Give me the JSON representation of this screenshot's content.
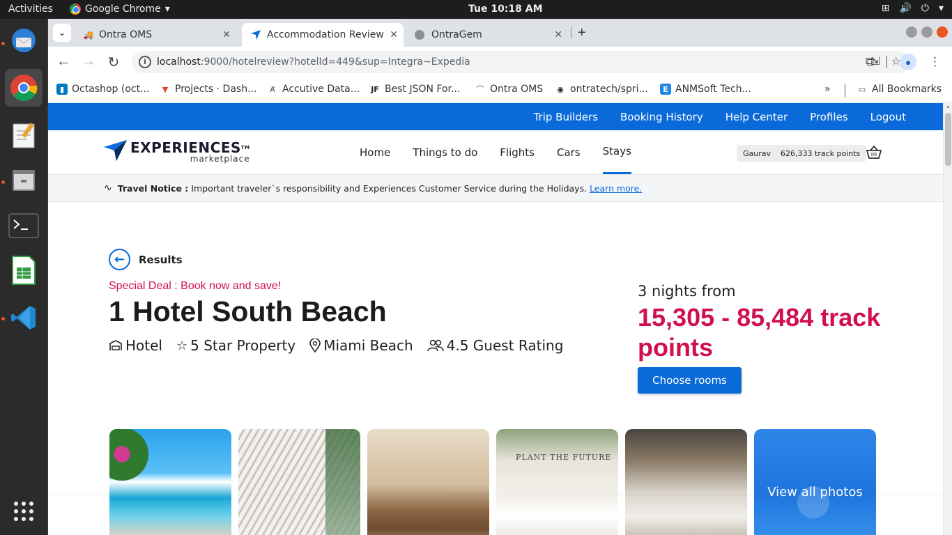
{
  "os": {
    "activities": "Activities",
    "app_name": "Google Chrome",
    "clock": "Tue 10:18 AM"
  },
  "browser": {
    "tabs": [
      {
        "title": "Ontra OMS"
      },
      {
        "title": "Accommodation Review"
      },
      {
        "title": "OntraGem"
      }
    ],
    "url_host": "localhost",
    "url_path": ":9000/hotelreview?hotelId=449&sup=Integra~Expedia",
    "bookmarks": [
      {
        "label": "Octashop (oct..."
      },
      {
        "label": "Projects · Dash..."
      },
      {
        "label": "Accutive Data..."
      },
      {
        "label": "Best JSON For..."
      },
      {
        "label": "Ontra OMS"
      },
      {
        "label": "ontratech/spri..."
      },
      {
        "label": "ANMSoft Tech..."
      }
    ],
    "all_bookmarks": "All Bookmarks"
  },
  "site": {
    "util_links": [
      "Trip Builders",
      "Booking History",
      "Help Center",
      "Profiles",
      "Logout"
    ],
    "brand": "EXPERIENCES",
    "brand_tm": "TM",
    "brand_sub": "marketplace",
    "nav": [
      "Home",
      "Things to do",
      "Flights",
      "Cars",
      "Stays"
    ],
    "user_name": "Gaurav",
    "user_points": "626,333",
    "user_points_unit": "track points",
    "notice_label": "Travel Notice :",
    "notice_text": "Important traveler`s responsibility and Experiences Customer Service during the Holidays.",
    "notice_link": "Learn more."
  },
  "hotel": {
    "back_label": "Results",
    "deal": "Special Deal : Book now and save!",
    "name": "1 Hotel South Beach",
    "type": "Hotel",
    "stars": "5 Star Property",
    "location": "Miami Beach",
    "rating": "4.5 Guest Rating",
    "nights": "3 nights from",
    "price": "15,305 - 85,484 track points",
    "cta": "Choose rooms",
    "photo_sign": "PLANT THE FUTURE",
    "view_all": "View all photos"
  },
  "colors": {
    "brand_blue": "#0a6ad9",
    "deal_red": "#d0104c"
  }
}
